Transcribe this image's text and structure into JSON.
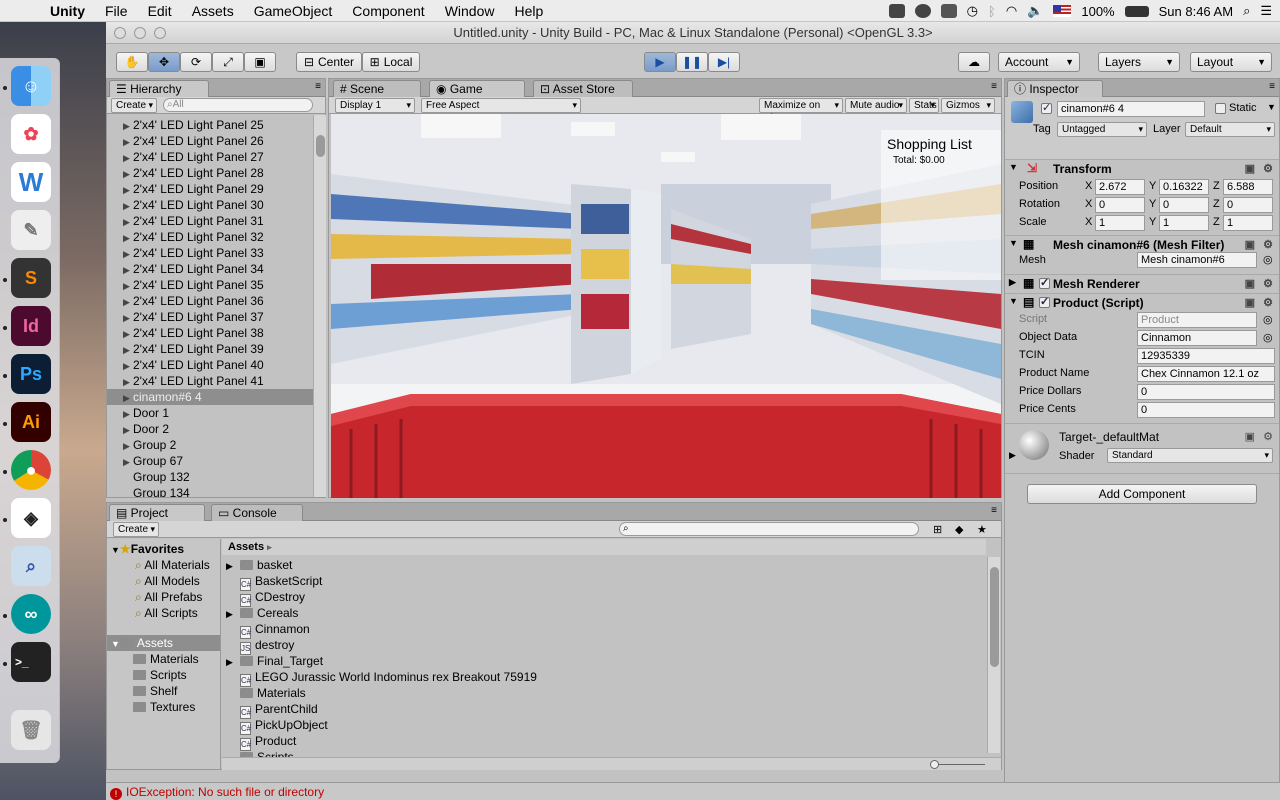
{
  "menubar": {
    "app_name": "Unity",
    "items": [
      "File",
      "Edit",
      "Assets",
      "GameObject",
      "Component",
      "Window",
      "Help"
    ],
    "battery": "100%",
    "clock": "Sun 8:46 AM"
  },
  "window": {
    "title": "Untitled.unity - Unity Build - PC, Mac & Linux Standalone (Personal) <OpenGL 3.3>"
  },
  "toolbar": {
    "pivot_label": "Center",
    "space_label": "Local",
    "account_label": "Account",
    "layers_label": "Layers",
    "layout_label": "Layout"
  },
  "hierarchy": {
    "tab_label": "Hierarchy",
    "create_label": "Create",
    "search_placeholder": "All",
    "rows": [
      {
        "label": "2'x4' LED Light Panel 25"
      },
      {
        "label": "2'x4' LED Light Panel 26"
      },
      {
        "label": "2'x4' LED Light Panel 27"
      },
      {
        "label": "2'x4' LED Light Panel 28"
      },
      {
        "label": "2'x4' LED Light Panel 29"
      },
      {
        "label": "2'x4' LED Light Panel 30"
      },
      {
        "label": "2'x4' LED Light Panel 31"
      },
      {
        "label": "2'x4' LED Light Panel 32"
      },
      {
        "label": "2'x4' LED Light Panel 33"
      },
      {
        "label": "2'x4' LED Light Panel 34"
      },
      {
        "label": "2'x4' LED Light Panel 35"
      },
      {
        "label": "2'x4' LED Light Panel 36"
      },
      {
        "label": "2'x4' LED Light Panel 37"
      },
      {
        "label": "2'x4' LED Light Panel 38"
      },
      {
        "label": "2'x4' LED Light Panel 39"
      },
      {
        "label": "2'x4' LED Light Panel 40"
      },
      {
        "label": "2'x4' LED Light Panel 41"
      },
      {
        "label": "cinamon#6 4"
      },
      {
        "label": "Door 1"
      },
      {
        "label": "Door 2"
      },
      {
        "label": "Group 2"
      },
      {
        "label": "Group 67"
      },
      {
        "label": "Group 132"
      },
      {
        "label": "Group 134"
      }
    ]
  },
  "game_view": {
    "tabs": [
      "Scene",
      "Game",
      "Asset Store"
    ],
    "display_label": "Display 1",
    "aspect_label": "Free Aspect",
    "options": [
      "Maximize on Play",
      "Mute audio",
      "Stats",
      "Gizmos"
    ],
    "hud_title": "Shopping List",
    "hud_total": "Total: $0.00"
  },
  "inspector": {
    "tab_label": "Inspector",
    "object_name": "cinamon#6 4",
    "static_label": "Static",
    "tag_label": "Tag",
    "tag_value": "Untagged",
    "layer_label": "Layer",
    "layer_value": "Default",
    "transform": {
      "title": "Transform",
      "rows": [
        {
          "label": "Position",
          "x": "2.672",
          "y": "0.16322",
          "z": "6.588"
        },
        {
          "label": "Rotation",
          "x": "0",
          "y": "0",
          "z": "0"
        },
        {
          "label": "Scale",
          "x": "1",
          "y": "1",
          "z": "1"
        }
      ]
    },
    "mesh_filter": {
      "title": "Mesh cinamon#6 (Mesh Filter)",
      "mesh_label": "Mesh",
      "mesh_value": "Mesh cinamon#6"
    },
    "mesh_renderer": {
      "title": "Mesh Renderer"
    },
    "product_script": {
      "title": "Product (Script)",
      "rows": [
        {
          "label": "Script",
          "value": "Product"
        },
        {
          "label": "Object Data",
          "value": "Cinnamon"
        },
        {
          "label": "TCIN",
          "value": "12935339"
        },
        {
          "label": "Product Name",
          "value": "Chex Cinnamon 12.1 oz"
        },
        {
          "label": "Price Dollars",
          "value": "0"
        },
        {
          "label": "Price Cents",
          "value": "0"
        }
      ]
    },
    "material": {
      "name": "Target-_defaultMat",
      "shader_label": "Shader",
      "shader_value": "Standard"
    },
    "add_component_label": "Add Component"
  },
  "project": {
    "tabs": [
      "Project",
      "Console"
    ],
    "create_label": "Create",
    "favorites_label": "Favorites",
    "favorites": [
      "All Materials",
      "All Models",
      "All Prefabs",
      "All Scripts"
    ],
    "assets_label": "Assets",
    "asset_folders": [
      "Materials",
      "Scripts",
      "Shelf",
      "Textures"
    ],
    "breadcrumb": "Assets",
    "assets": [
      {
        "label": "basket"
      },
      {
        "label": "BasketScript"
      },
      {
        "label": "CDestroy"
      },
      {
        "label": "Cereals"
      },
      {
        "label": "Cinnamon"
      },
      {
        "label": "destroy"
      },
      {
        "label": "Final_Target"
      },
      {
        "label": "LEGO Jurassic World Indominus rex Breakout 75919"
      },
      {
        "label": "Materials"
      },
      {
        "label": "ParentChild"
      },
      {
        "label": "PickUpObject"
      },
      {
        "label": "Product"
      },
      {
        "label": "Scripts"
      }
    ]
  },
  "status_bar": {
    "message": "IOException: No such file or directory"
  },
  "colors": {
    "accent_play": "#6f92c8",
    "basket_red": "#c8262d",
    "error_red": "#c00000"
  }
}
